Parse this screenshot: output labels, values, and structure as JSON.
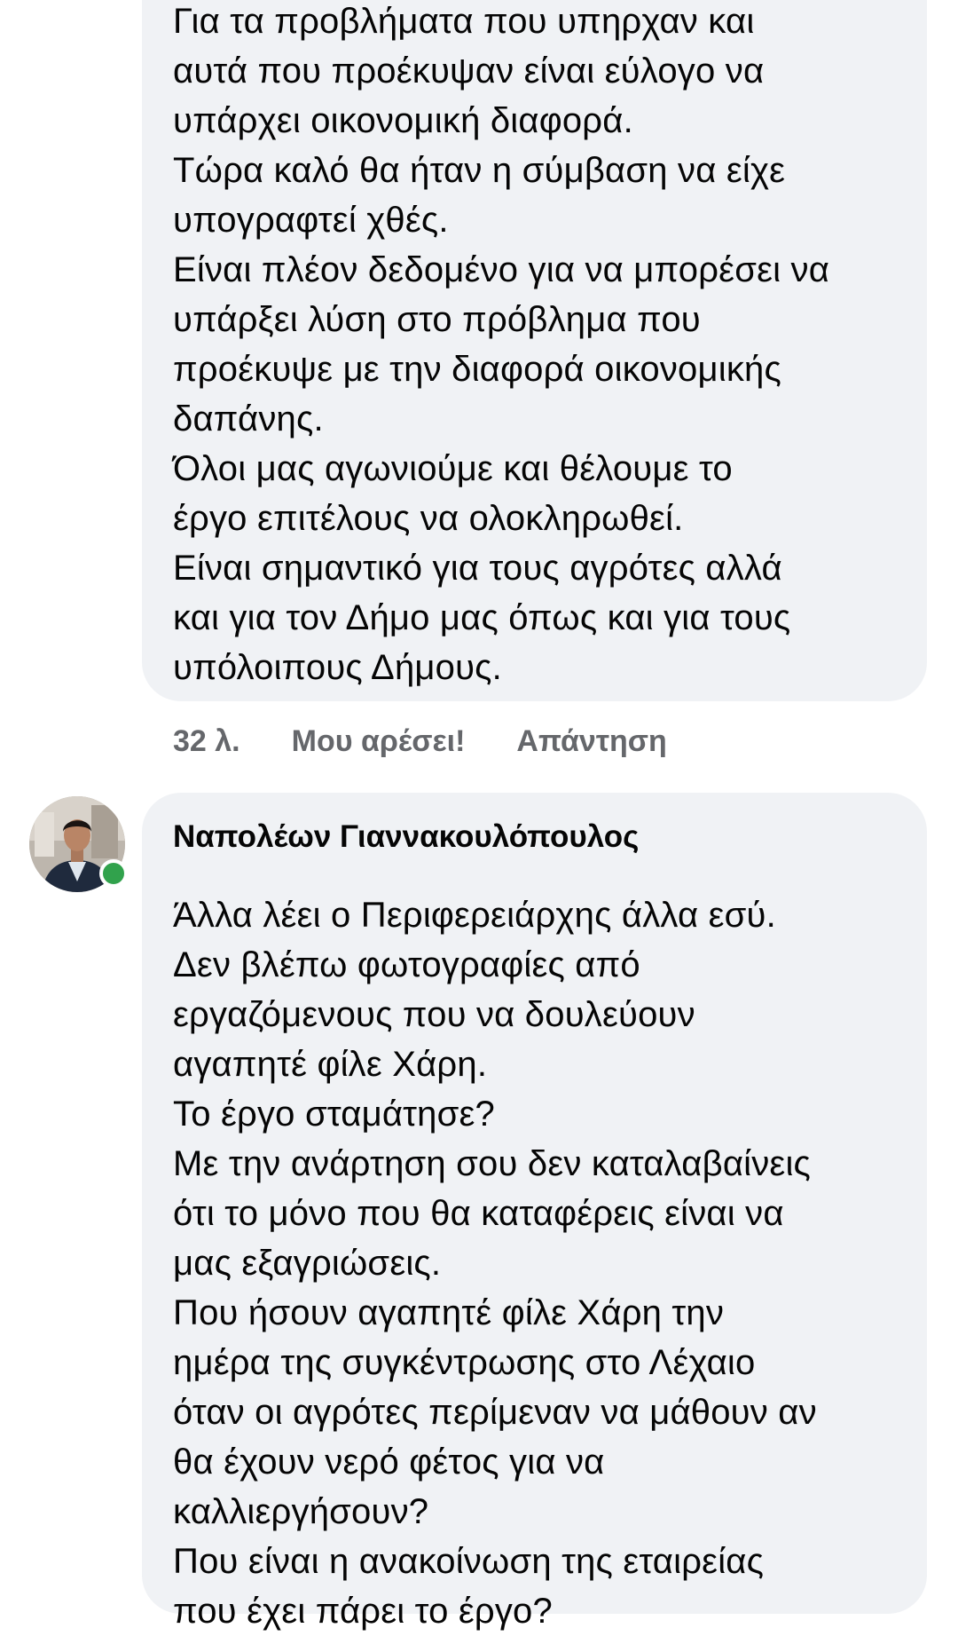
{
  "comment1": {
    "lines": [
      "Για τα προβλήματα που υπηρχαν και",
      "αυτά που προέκυψαν είναι εύλογο να",
      "υπάρχει οικονομική διαφορά.",
      "Τώρα καλό θα ήταν η σύμβαση να  είχε",
      "υπογραφτεί χθές.",
      "Είναι πλέον δεδομένο για να μπορέσει να",
      "υπάρξει λύση στο πρόβλημα που",
      "προέκυψε με την διαφορά οικονομικής",
      "δαπάνης.",
      "Όλοι μας αγωνιούμε και θέλουμε το",
      "έργο επιτέλους να ολοκληρωθεί.",
      "Είναι σημαντικό για τους αγρότες αλλά",
      "και για τον Δήμο μας όπως και για τους",
      "υπόλοιπους Δήμους."
    ]
  },
  "actions": {
    "time": "32 λ.",
    "like": "Μου αρέσει!",
    "reply": "Απάντηση"
  },
  "comment2": {
    "author": "Ναπολέων Γιαννακουλόπουλος",
    "avatar_icon": "profile-photo-icon",
    "online_color": "#31a24c",
    "lines": [
      "Άλλα λέει ο Περιφερειάρχης άλλα εσύ.",
      "Δεν βλέπω φωτογραφίες από",
      "εργαζόμενους που να δουλεύουν",
      "αγαπητέ φίλε Χάρη.",
      "Το έργο σταμάτησε?",
      "Με την ανάρτηση σου δεν καταλαβαίνεις",
      "ότι το μόνο που θα καταφέρεις είναι να",
      "μας εξαγριώσεις.",
      "Που ήσουν αγαπητέ φίλε Χάρη την",
      "ημέρα της συγκέντρωσης στο Λέχαιο",
      "όταν οι αγρότες περίμεναν να μάθουν αν",
      "θα έχουν νερό φέτος για να",
      "καλλιεργήσουν?",
      "Που είναι η ανακοίνωση της εταιρείας",
      "που έχει πάρει το έργο?"
    ]
  }
}
